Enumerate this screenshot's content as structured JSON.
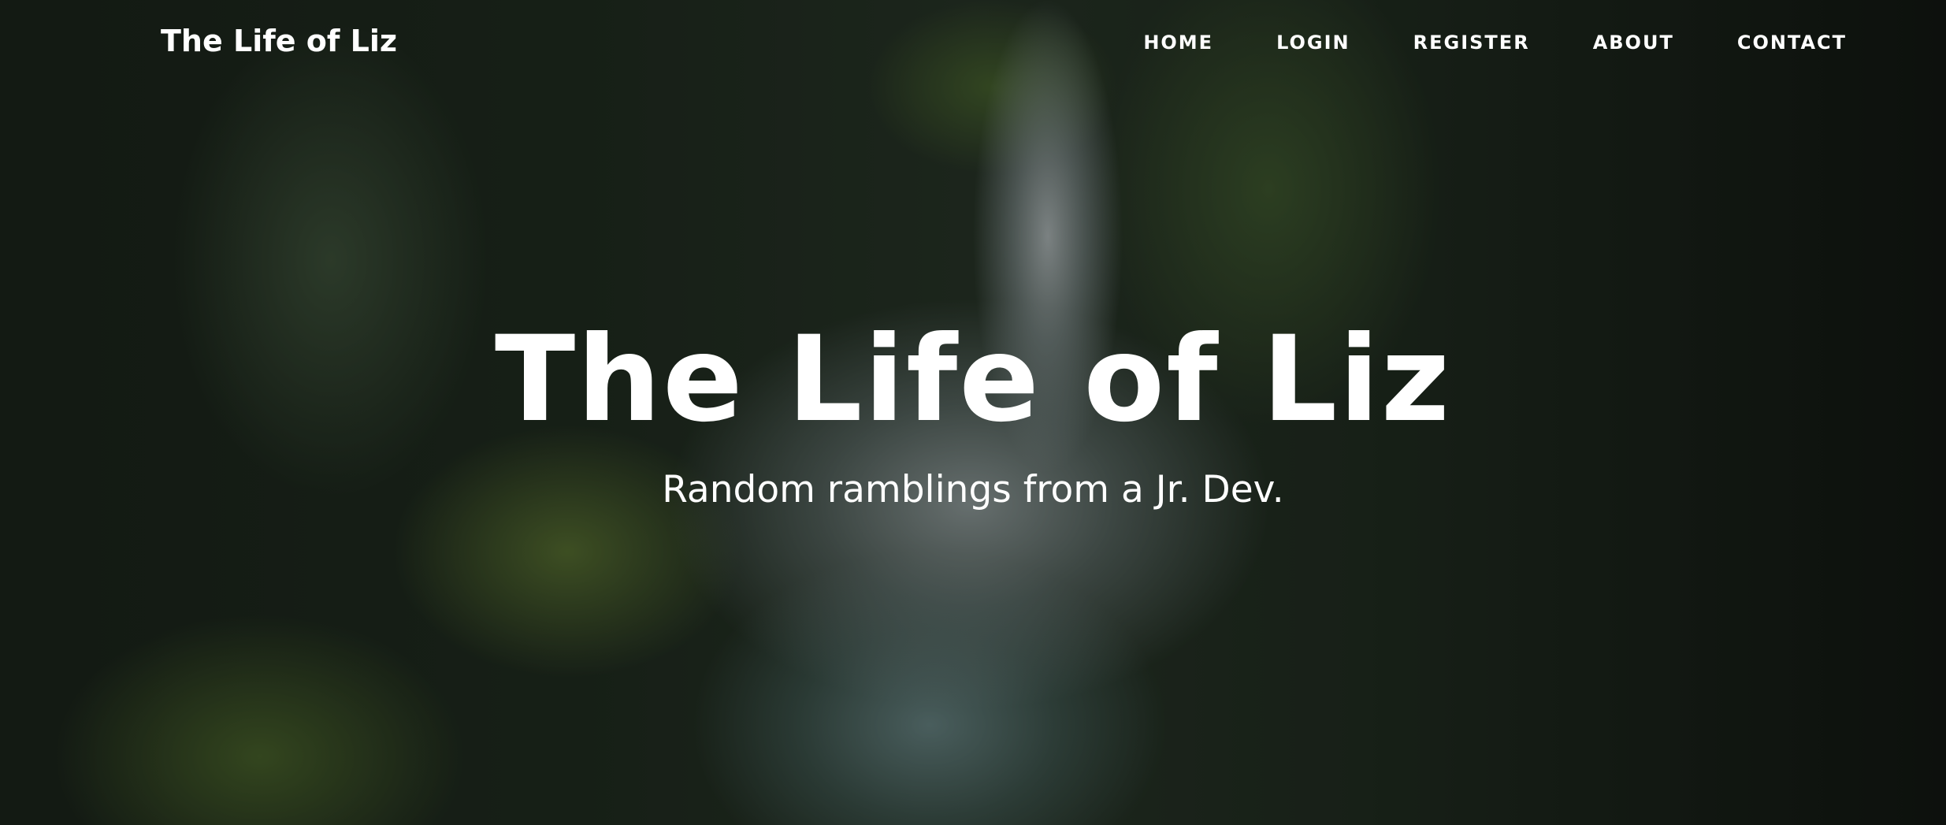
{
  "navbar": {
    "brand": "The Life of Liz",
    "links": [
      {
        "label": "HOME"
      },
      {
        "label": "LOGIN"
      },
      {
        "label": "REGISTER"
      },
      {
        "label": "ABOUT"
      },
      {
        "label": "CONTACT"
      }
    ]
  },
  "hero": {
    "title": "The Life of Liz",
    "subtitle": "Random ramblings from a Jr. Dev.",
    "background_image": "waterfall-forest-photo",
    "overlay_color": "#000000"
  }
}
